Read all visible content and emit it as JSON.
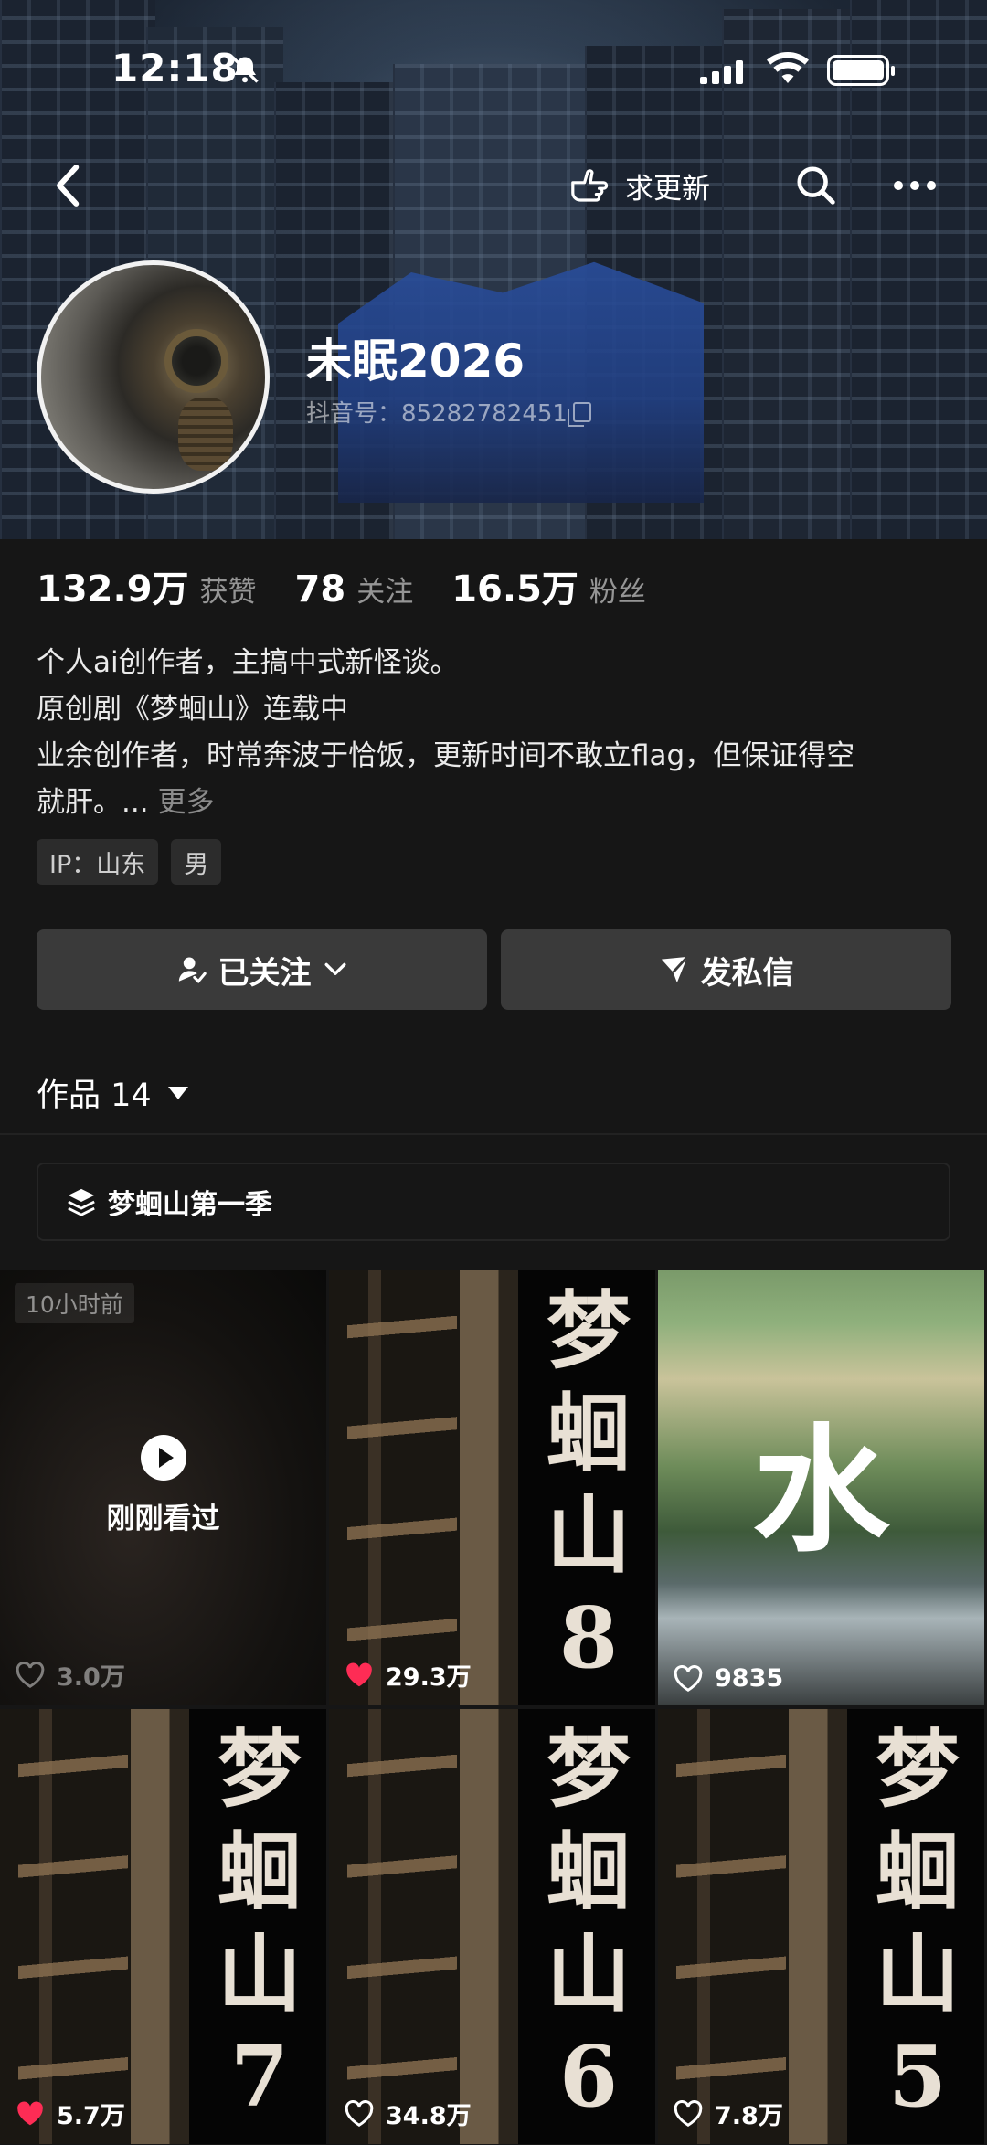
{
  "status_bar": {
    "time": "12:18"
  },
  "nav": {
    "update_label": "求更新"
  },
  "profile": {
    "name": "未眠2026",
    "douyin_id": "抖音号：85282782451"
  },
  "stats": [
    {
      "value": "132.9万",
      "label": "获赞"
    },
    {
      "value": "78",
      "label": "关注"
    },
    {
      "value": "16.5万",
      "label": "粉丝"
    }
  ],
  "bio": {
    "line1": "个人ai创作者，主搞中式新怪谈。",
    "line2": "原创剧《梦蛔山》连载中",
    "line3": "业余创作者，时常奔波于恰饭，更新时间不敢立flag，但保证得空",
    "line4": "就肝。...",
    "more": "更多"
  },
  "tags": [
    "IP：山东",
    "男"
  ],
  "buttons": {
    "follow": "已关注",
    "message": "发私信"
  },
  "works": {
    "label": "作品 14"
  },
  "collection": {
    "title": "梦蛔山第一季"
  },
  "videos": [
    {
      "likes": "3.0万",
      "ago": "10小时前",
      "played": "刚刚看过",
      "liked": false
    },
    {
      "likes": "29.3万",
      "cover_text": "梦蛔山8",
      "liked": true
    },
    {
      "likes": "9835",
      "cover_text": "水",
      "liked": false
    },
    {
      "likes": "5.7万",
      "cover_text": "梦蛔山7",
      "liked": true
    },
    {
      "likes": "34.8万",
      "cover_text": "梦蛔山6",
      "liked": false
    },
    {
      "likes": "7.8万",
      "cover_text": "梦蛔山5",
      "liked": false
    }
  ],
  "colors": {
    "accent_like": "#fe2c55",
    "button_bg": "#3a3a3a",
    "page_bg": "#161616"
  }
}
